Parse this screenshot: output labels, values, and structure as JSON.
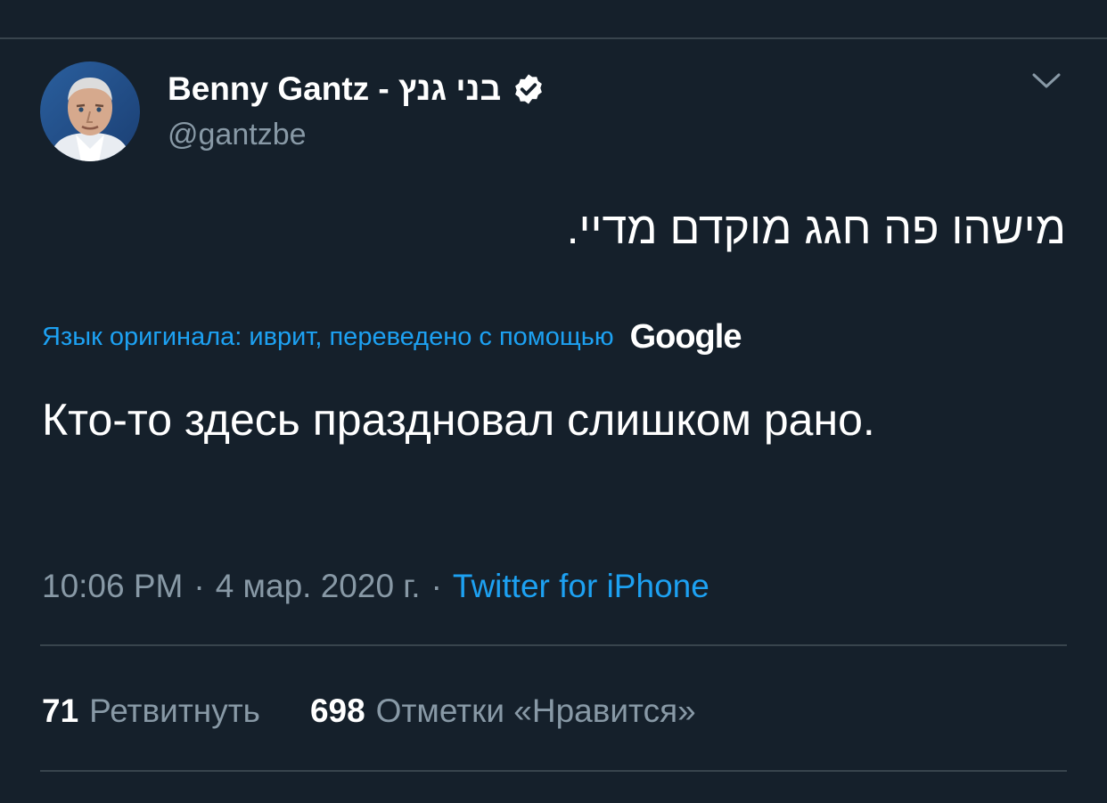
{
  "tweet": {
    "author": {
      "display_name": "Benny Gantz - בני גנץ",
      "handle": "@gantzbe",
      "verified": true
    },
    "original_text": "מישהו פה חגג מוקדם מדיי.",
    "translation": {
      "notice": "Язык оригинала: иврит, переведено с помощью",
      "provider": "Google",
      "text": "Кто-то здесь праздновал слишком рано."
    },
    "meta": {
      "time": "10:06 PM",
      "separator": "·",
      "date": "4 мар. 2020 г.",
      "source": "Twitter for iPhone"
    },
    "stats": {
      "retweets_count": "71",
      "retweets_label": "Ретвитнуть",
      "likes_count": "698",
      "likes_label": "Отметки «Нравится»"
    }
  },
  "colors": {
    "background": "#15202b",
    "divider": "#38444d",
    "accent": "#1da1f2",
    "secondary_text": "#8899a6",
    "primary_text": "#ffffff"
  },
  "icons": {
    "verified": "verified-badge-icon",
    "menu": "chevron-down-icon",
    "avatar": "profile-avatar"
  }
}
